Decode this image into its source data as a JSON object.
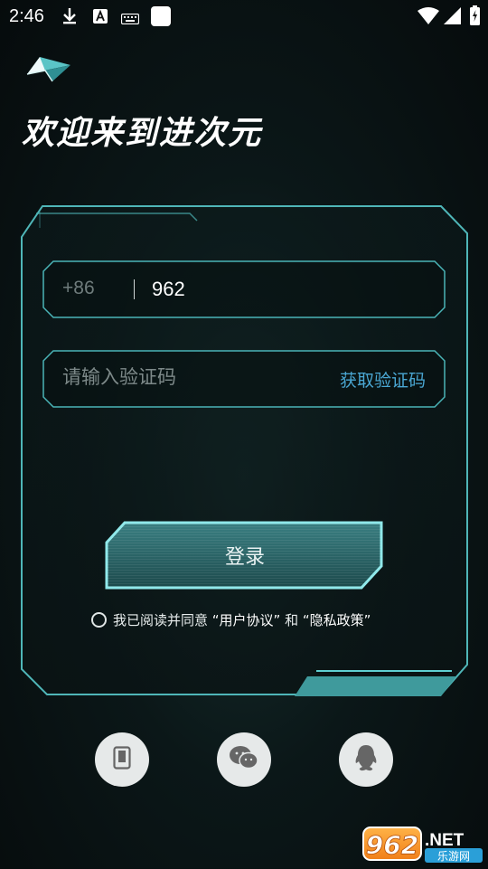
{
  "status_bar": {
    "time": "2:46",
    "left_icons": [
      "download-icon",
      "font-icon",
      "keyboard-icon",
      "square-icon"
    ],
    "right_icons": [
      "wifi-icon",
      "signal-icon",
      "battery-icon"
    ]
  },
  "header": {
    "logo": "paper-plane-logo",
    "title": "欢迎来到进次元"
  },
  "login_form": {
    "country_code": "+86",
    "phone_value": "962",
    "code_placeholder": "请输入验证码",
    "get_code_label": "获取验证码",
    "login_label": "登录"
  },
  "agreement": {
    "prefix": "我已阅读并同意 ",
    "user_agreement": "“用户协议”",
    "and": " 和 ",
    "privacy_policy": "“隐私政策”",
    "checked": false
  },
  "social_login": [
    {
      "icon": "phone-icon"
    },
    {
      "icon": "wechat-icon"
    },
    {
      "icon": "qq-icon"
    }
  ],
  "watermark": {
    "number": "962",
    "suffix": ".NET",
    "subtitle": "乐游网"
  },
  "colors": {
    "accent_teal": "#5fcfd1",
    "link_blue": "#4aa7d3",
    "background": "#0b1718"
  }
}
